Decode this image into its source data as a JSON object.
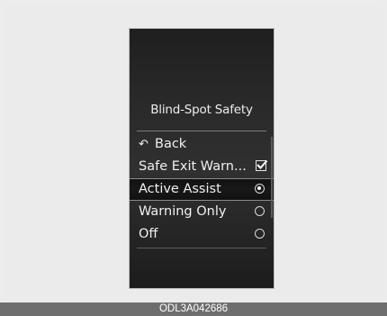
{
  "screen": {
    "title": "Blind-Spot Safety",
    "back": {
      "icon": "back-arrow-icon",
      "label": "Back"
    },
    "items": [
      {
        "label": "Safe Exit Warn...",
        "control": "checkbox",
        "checked": true
      },
      {
        "label": "Active Assist",
        "control": "radio",
        "selected": true
      },
      {
        "label": "Warning Only",
        "control": "radio",
        "selected": false
      },
      {
        "label": "Off",
        "control": "radio",
        "selected": false
      }
    ]
  },
  "caption": "ODL3A042686"
}
